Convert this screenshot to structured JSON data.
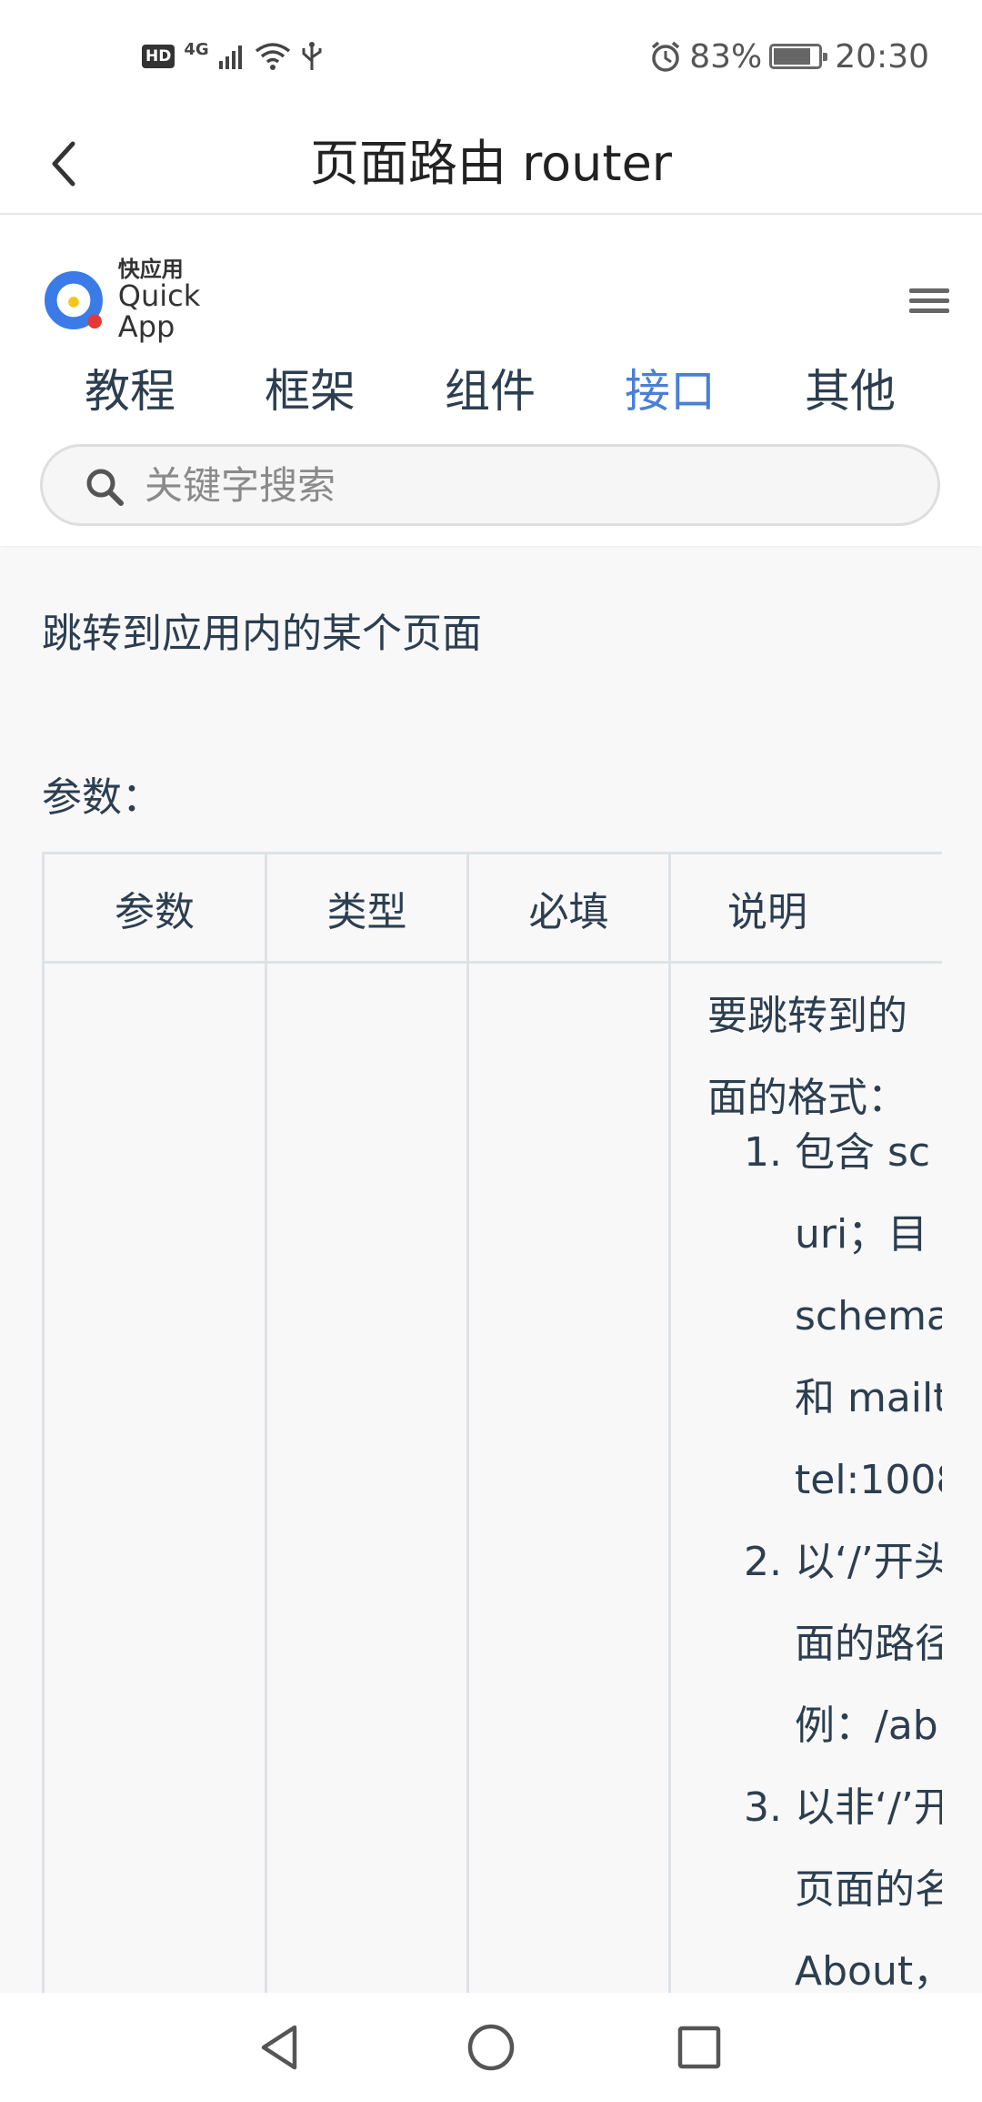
{
  "status_bar": {
    "network": "4G",
    "battery_percent": "83%",
    "battery_level": 0.83,
    "time": "20:30"
  },
  "titlebar": {
    "title": "页面路由 router"
  },
  "header": {
    "logo_cn": "快应用",
    "logo_en": "Quick App",
    "nav": [
      "教程",
      "框架",
      "组件",
      "接口",
      "其他"
    ],
    "active_nav": "接口",
    "search_placeholder": "关键字搜索",
    "accent_color": "#4a7fd6"
  },
  "content": {
    "intro": "跳转到应用内的某个页面",
    "params_label": "参数：",
    "table": {
      "headers": [
        "参数",
        "类型",
        "必填",
        "说明"
      ],
      "description": {
        "intro_lines": [
          "要跳转到的",
          "面的格式："
        ],
        "items": [
          {
            "num": "1.",
            "lines": [
              "包含 sc",
              "uri；目",
              "schema",
              "和 mailt",
              "tel:1008"
            ]
          },
          {
            "num": "2.",
            "lines": [
              "以‘/’开头",
              "面的路径",
              "例：/ab"
            ]
          },
          {
            "num": "3.",
            "lines": [
              "以非‘/’开",
              "页面的名",
              "About，"
            ]
          }
        ]
      }
    }
  },
  "icons": {
    "back": "chevron-left-icon",
    "menu": "hamburger-menu-icon",
    "search": "search-icon",
    "nav_back": "triangle-back-icon",
    "nav_home": "circle-home-icon",
    "nav_recent": "square-recent-icon"
  }
}
